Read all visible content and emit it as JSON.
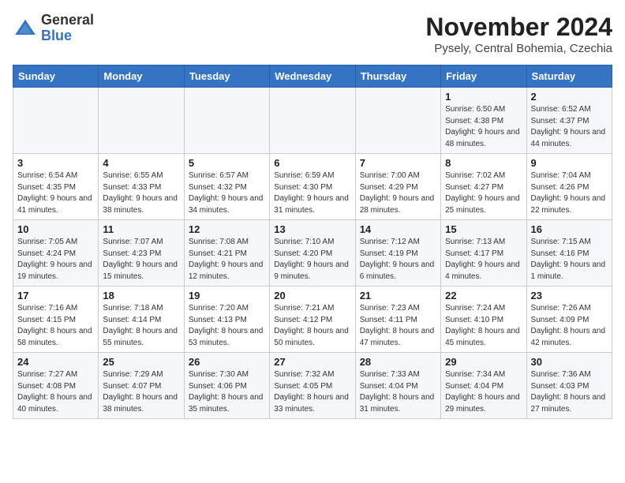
{
  "logo": {
    "general": "General",
    "blue": "Blue"
  },
  "title": "November 2024",
  "location": "Pysely, Central Bohemia, Czechia",
  "days_of_week": [
    "Sunday",
    "Monday",
    "Tuesday",
    "Wednesday",
    "Thursday",
    "Friday",
    "Saturday"
  ],
  "weeks": [
    [
      {
        "day": "",
        "info": ""
      },
      {
        "day": "",
        "info": ""
      },
      {
        "day": "",
        "info": ""
      },
      {
        "day": "",
        "info": ""
      },
      {
        "day": "",
        "info": ""
      },
      {
        "day": "1",
        "info": "Sunrise: 6:50 AM\nSunset: 4:38 PM\nDaylight: 9 hours\nand 48 minutes."
      },
      {
        "day": "2",
        "info": "Sunrise: 6:52 AM\nSunset: 4:37 PM\nDaylight: 9 hours\nand 44 minutes."
      }
    ],
    [
      {
        "day": "3",
        "info": "Sunrise: 6:54 AM\nSunset: 4:35 PM\nDaylight: 9 hours\nand 41 minutes."
      },
      {
        "day": "4",
        "info": "Sunrise: 6:55 AM\nSunset: 4:33 PM\nDaylight: 9 hours\nand 38 minutes."
      },
      {
        "day": "5",
        "info": "Sunrise: 6:57 AM\nSunset: 4:32 PM\nDaylight: 9 hours\nand 34 minutes."
      },
      {
        "day": "6",
        "info": "Sunrise: 6:59 AM\nSunset: 4:30 PM\nDaylight: 9 hours\nand 31 minutes."
      },
      {
        "day": "7",
        "info": "Sunrise: 7:00 AM\nSunset: 4:29 PM\nDaylight: 9 hours\nand 28 minutes."
      },
      {
        "day": "8",
        "info": "Sunrise: 7:02 AM\nSunset: 4:27 PM\nDaylight: 9 hours\nand 25 minutes."
      },
      {
        "day": "9",
        "info": "Sunrise: 7:04 AM\nSunset: 4:26 PM\nDaylight: 9 hours\nand 22 minutes."
      }
    ],
    [
      {
        "day": "10",
        "info": "Sunrise: 7:05 AM\nSunset: 4:24 PM\nDaylight: 9 hours\nand 19 minutes."
      },
      {
        "day": "11",
        "info": "Sunrise: 7:07 AM\nSunset: 4:23 PM\nDaylight: 9 hours\nand 15 minutes."
      },
      {
        "day": "12",
        "info": "Sunrise: 7:08 AM\nSunset: 4:21 PM\nDaylight: 9 hours\nand 12 minutes."
      },
      {
        "day": "13",
        "info": "Sunrise: 7:10 AM\nSunset: 4:20 PM\nDaylight: 9 hours\nand 9 minutes."
      },
      {
        "day": "14",
        "info": "Sunrise: 7:12 AM\nSunset: 4:19 PM\nDaylight: 9 hours\nand 6 minutes."
      },
      {
        "day": "15",
        "info": "Sunrise: 7:13 AM\nSunset: 4:17 PM\nDaylight: 9 hours\nand 4 minutes."
      },
      {
        "day": "16",
        "info": "Sunrise: 7:15 AM\nSunset: 4:16 PM\nDaylight: 9 hours\nand 1 minute."
      }
    ],
    [
      {
        "day": "17",
        "info": "Sunrise: 7:16 AM\nSunset: 4:15 PM\nDaylight: 8 hours\nand 58 minutes."
      },
      {
        "day": "18",
        "info": "Sunrise: 7:18 AM\nSunset: 4:14 PM\nDaylight: 8 hours\nand 55 minutes."
      },
      {
        "day": "19",
        "info": "Sunrise: 7:20 AM\nSunset: 4:13 PM\nDaylight: 8 hours\nand 53 minutes."
      },
      {
        "day": "20",
        "info": "Sunrise: 7:21 AM\nSunset: 4:12 PM\nDaylight: 8 hours\nand 50 minutes."
      },
      {
        "day": "21",
        "info": "Sunrise: 7:23 AM\nSunset: 4:11 PM\nDaylight: 8 hours\nand 47 minutes."
      },
      {
        "day": "22",
        "info": "Sunrise: 7:24 AM\nSunset: 4:10 PM\nDaylight: 8 hours\nand 45 minutes."
      },
      {
        "day": "23",
        "info": "Sunrise: 7:26 AM\nSunset: 4:09 PM\nDaylight: 8 hours\nand 42 minutes."
      }
    ],
    [
      {
        "day": "24",
        "info": "Sunrise: 7:27 AM\nSunset: 4:08 PM\nDaylight: 8 hours\nand 40 minutes."
      },
      {
        "day": "25",
        "info": "Sunrise: 7:29 AM\nSunset: 4:07 PM\nDaylight: 8 hours\nand 38 minutes."
      },
      {
        "day": "26",
        "info": "Sunrise: 7:30 AM\nSunset: 4:06 PM\nDaylight: 8 hours\nand 35 minutes."
      },
      {
        "day": "27",
        "info": "Sunrise: 7:32 AM\nSunset: 4:05 PM\nDaylight: 8 hours\nand 33 minutes."
      },
      {
        "day": "28",
        "info": "Sunrise: 7:33 AM\nSunset: 4:04 PM\nDaylight: 8 hours\nand 31 minutes."
      },
      {
        "day": "29",
        "info": "Sunrise: 7:34 AM\nSunset: 4:04 PM\nDaylight: 8 hours\nand 29 minutes."
      },
      {
        "day": "30",
        "info": "Sunrise: 7:36 AM\nSunset: 4:03 PM\nDaylight: 8 hours\nand 27 minutes."
      }
    ]
  ]
}
